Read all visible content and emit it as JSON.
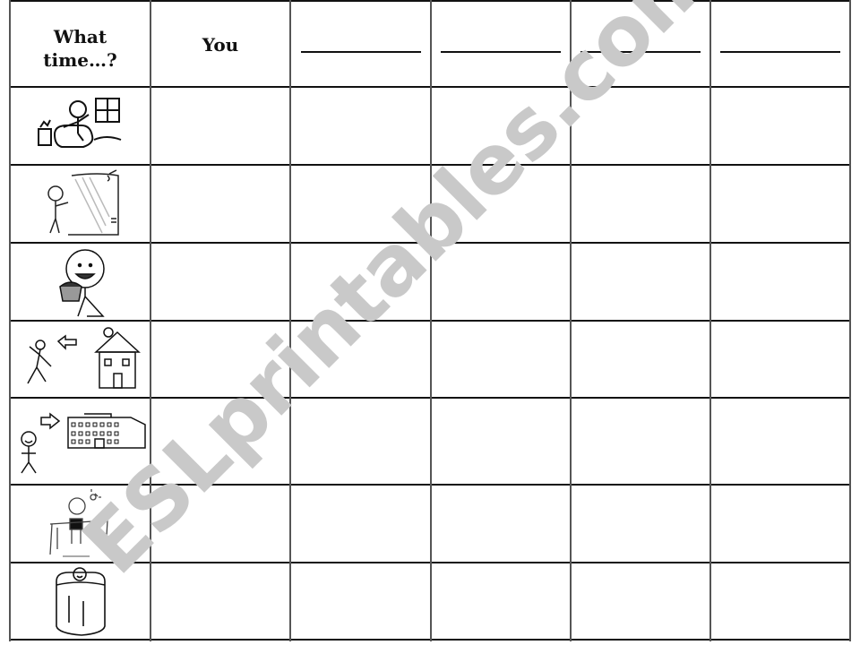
{
  "table": {
    "header": {
      "first_col_line1": "What",
      "first_col_line2": "time…?",
      "you_label": "You",
      "blank_columns": 4
    },
    "rows": [
      {
        "activity_icon": "wake-up-icon",
        "activity": "get up"
      },
      {
        "activity_icon": "shower-icon",
        "activity": "take a shower"
      },
      {
        "activity_icon": "eat-breakfast-icon",
        "activity": "have breakfast"
      },
      {
        "activity_icon": "leave-home-icon",
        "activity": "leave home"
      },
      {
        "activity_icon": "go-to-school-icon",
        "activity": "go to school"
      },
      {
        "activity_icon": "do-homework-icon",
        "activity": "do homework"
      },
      {
        "activity_icon": "go-to-bed-icon",
        "activity": "go to bed"
      }
    ]
  },
  "watermark": "ESLprintables.com",
  "colors": {
    "grid": "#111111",
    "watermark": "#c9c9c9"
  }
}
